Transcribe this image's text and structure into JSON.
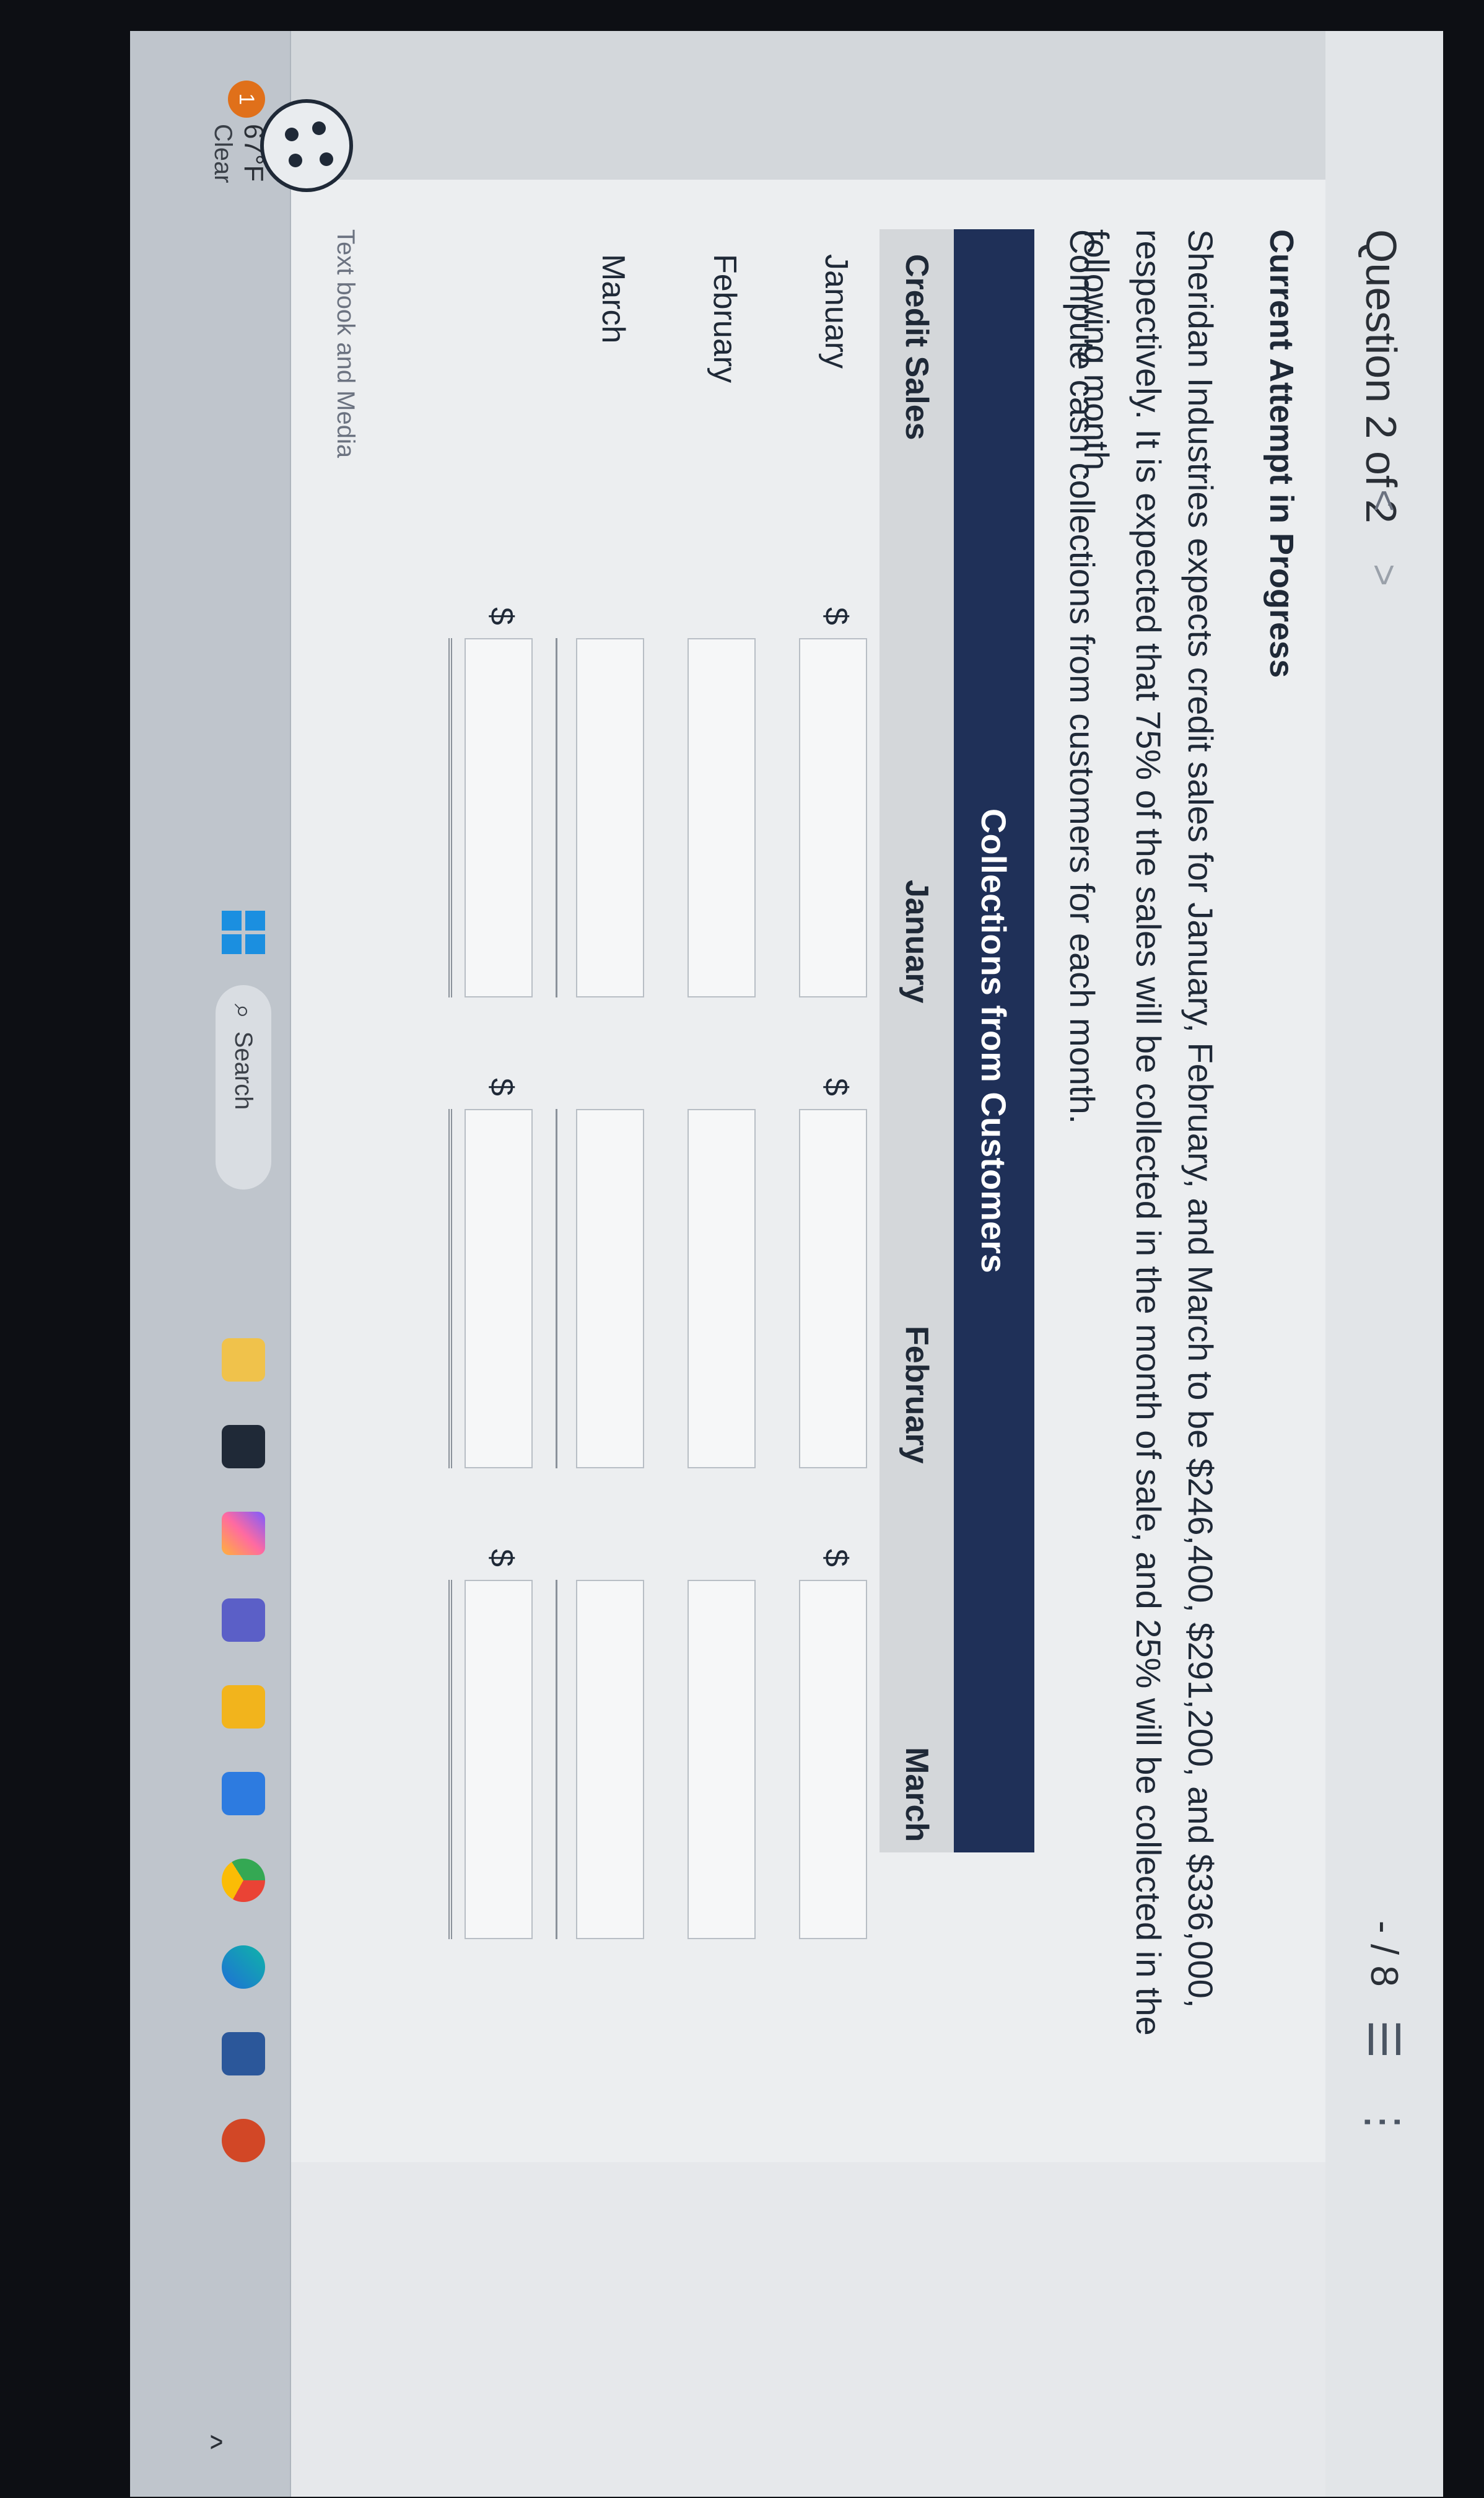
{
  "header": {
    "question_label": "Question 2 of 2",
    "prev_glyph": "<",
    "next_glyph": ">",
    "score": "- / 8",
    "list_glyph": "☰",
    "more_glyph": "⋮"
  },
  "content": {
    "attempt_status": "Current Attempt in Progress",
    "problem_text": "Sheridan Industries expects credit sales for January, February, and March to be $246,400, $291,200, and $336,000, respectively. It is expected that 75% of the sales will be collected in the month of sale, and 25% will be collected in the following month.",
    "instruction": "Compute cash collections from customers for each month."
  },
  "table": {
    "title": "Collections from Customers",
    "headers": {
      "credit_sales": "Credit Sales",
      "january": "January",
      "february": "February",
      "march": "March"
    },
    "rows": [
      "January",
      "February",
      "March"
    ],
    "currency_symbol": "$"
  },
  "attachments_peek": "Text book and Media",
  "taskbar": {
    "weather_badge": "1",
    "temperature": "67°F",
    "condition": "Clear",
    "search_label": "Search",
    "search_glyph": "⌕"
  },
  "colors": {
    "table_header": "#1f3058",
    "start_blue": "#1b8fe0"
  },
  "icons": [
    "windows-start-icon",
    "search-icon",
    "file-explorer-icon",
    "teams-icon",
    "copilot-icon",
    "edge-icon",
    "chrome-icon",
    "word-icon",
    "powerpoint-icon",
    "weather-icon",
    "palette-icon"
  ]
}
